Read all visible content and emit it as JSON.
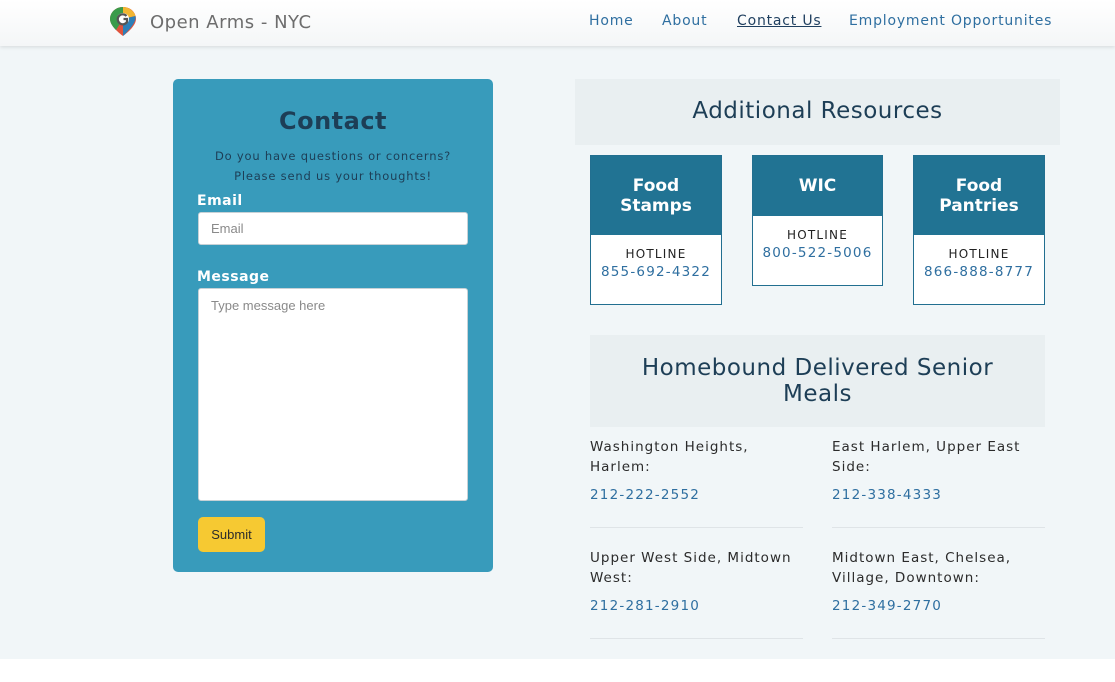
{
  "brand": {
    "name": "Open Arms",
    "separator": " - ",
    "city": "NYC",
    "logo_icon": "location-pin-logo-icon"
  },
  "nav": {
    "items": [
      {
        "label": "Home",
        "active": false
      },
      {
        "label": "About",
        "active": false
      },
      {
        "label": "Contact Us",
        "active": true
      },
      {
        "label": "Employment Opportunites",
        "active": false
      }
    ]
  },
  "contact": {
    "title": "Contact",
    "subtitle_line1": "Do you have questions or concerns?",
    "subtitle_line2": "Please send us your thoughts!",
    "email_label": "Email",
    "email_placeholder": "Email",
    "message_label": "Message",
    "message_placeholder": "Type message here",
    "submit_label": "Submit"
  },
  "resources": {
    "title": "Additional Resources",
    "cards": [
      {
        "name_line1": "Food",
        "name_line2": "Stamps",
        "hotline_label": "HOTLINE",
        "phone": "855-692-4322"
      },
      {
        "name_line1": "WIC",
        "name_line2": "",
        "hotline_label": "HOTLINE",
        "phone": "800-522-5006"
      },
      {
        "name_line1": "Food",
        "name_line2": "Pantries",
        "hotline_label": "HOTLINE",
        "phone": "866-888-8777"
      }
    ]
  },
  "homebound": {
    "title": "Homebound Delivered Senior Meals",
    "items": [
      {
        "area": "Washington Heights, Harlem:",
        "phone": "212-222-2552"
      },
      {
        "area": "East Harlem, Upper East Side:",
        "phone": "212-338-4333"
      },
      {
        "area": "Upper West Side, Midtown West:",
        "phone": "212-281-2910"
      },
      {
        "area": "Midtown East, Chelsea, Village, Downtown:",
        "phone": "212-349-2770"
      }
    ]
  },
  "colors": {
    "card_blue": "#389bbb",
    "header_blue": "#217393",
    "link_blue": "#2f6fa0",
    "submit_yellow": "#f6c932",
    "page_bg": "#f1f6f8"
  }
}
